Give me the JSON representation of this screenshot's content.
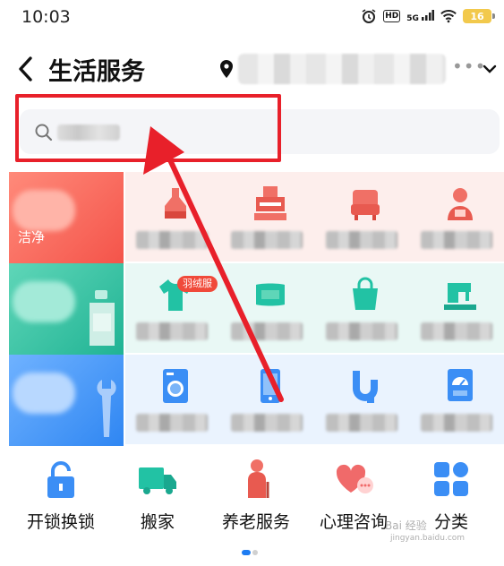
{
  "status_bar": {
    "time": "10:03",
    "network": "5G",
    "battery": "16"
  },
  "header": {
    "title": "生活服务",
    "location": "",
    "more": "•••"
  },
  "search": {
    "placeholder": ""
  },
  "grid": {
    "rows": [
      {
        "category_label": "洁净",
        "category_color": "#f46a5a",
        "cells": [
          {
            "icon": "cleaning-icon",
            "badge": ""
          },
          {
            "icon": "range-hood-icon",
            "badge": ""
          },
          {
            "icon": "sofa-icon",
            "badge": ""
          },
          {
            "icon": "housekeeper-icon",
            "badge": ""
          }
        ]
      },
      {
        "category_label": "",
        "category_color": "#2fc5a5",
        "cells": [
          {
            "icon": "tshirt-icon",
            "badge": "羽绒服"
          },
          {
            "icon": "pillow-icon",
            "badge": ""
          },
          {
            "icon": "bag-icon",
            "badge": ""
          },
          {
            "icon": "sewing-machine-icon",
            "badge": ""
          }
        ]
      },
      {
        "category_label": "",
        "category_color": "#3b8ef5",
        "cells": [
          {
            "icon": "washing-machine-icon",
            "badge": ""
          },
          {
            "icon": "phone-icon",
            "badge": ""
          },
          {
            "icon": "pipe-icon",
            "badge": ""
          },
          {
            "icon": "meter-icon",
            "badge": ""
          }
        ]
      }
    ]
  },
  "bottom_nav": [
    {
      "label": "开锁换锁",
      "icon": "lock-icon"
    },
    {
      "label": "搬家",
      "icon": "truck-icon"
    },
    {
      "label": "养老服务",
      "icon": "elderly-icon"
    },
    {
      "label": "心理咨询",
      "icon": "heart-chat-icon"
    },
    {
      "label": "分类",
      "icon": "grid-icon"
    }
  ],
  "watermark": {
    "line1": "Bai 经验",
    "line2": "jingyan.baidu.com"
  },
  "colors": {
    "accent": "#1e7cf2",
    "annotation": "#e8202a"
  }
}
